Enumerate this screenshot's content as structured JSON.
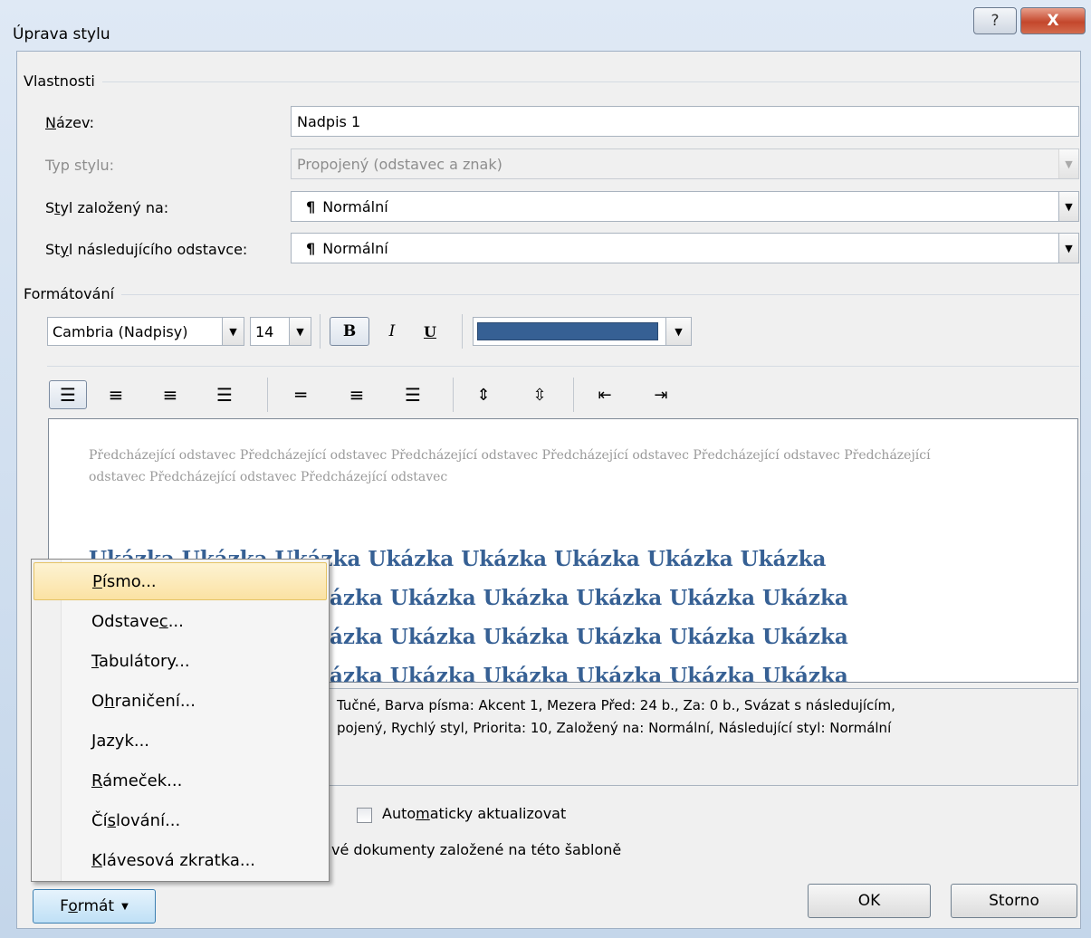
{
  "window": {
    "title": "Úprava stylu",
    "help_glyph": "?",
    "close_glyph": "X"
  },
  "properties": {
    "heading": "Vlastnosti",
    "name_label": "Název:",
    "name_value": "Nadpis 1",
    "type_label": "Typ stylu:",
    "type_value": "Propojený (odstavec a znak)",
    "based_label": "Styl založený na:",
    "based_value": "Normální",
    "next_label": "Styl následujícího odstavce:",
    "next_value": "Normální",
    "pilcrow": "¶"
  },
  "formatting": {
    "heading": "Formátování",
    "font": "Cambria (Nadpisy)",
    "size": "14",
    "bold": "B",
    "italic": "I",
    "underline": "U",
    "color": "#366094"
  },
  "preview": {
    "previous": "Předcházející odstavec Předcházející odstavec Předcházející odstavec Předcházející odstavec Předcházející odstavec Předcházející odstavec Předcházející odstavec Předcházející odstavec",
    "sample_line": "Ukázka Ukázka Ukázka Ukázka Ukázka Ukázka Ukázka Ukázka",
    "sample_visible": "ázka Ukázka Ukázka Ukázka Ukázka Ukázka"
  },
  "description": {
    "line1": "Tučné, Barva písma: Akcent 1, Mezera Před:  24 b., Za:  0 b., Svázat s následujícím,",
    "line2": "pojený, Rychlý styl, Priorita: 10, Založený na: Normální, Následující styl: Normální"
  },
  "auto_update_label": "Automaticky aktualizovat",
  "template_text": "vé dokumenty založené na této šabloně",
  "buttons": {
    "format": "Formát",
    "ok": "OK",
    "cancel": "Storno"
  },
  "menu": {
    "items": [
      {
        "pre": "",
        "key": "P",
        "post": "ísmo..."
      },
      {
        "pre": "Odstave",
        "key": "c",
        "post": "..."
      },
      {
        "pre": "",
        "key": "T",
        "post": "abulátory..."
      },
      {
        "pre": "O",
        "key": "h",
        "post": "raničení..."
      },
      {
        "pre": "",
        "key": "J",
        "post": "azyk..."
      },
      {
        "pre": "",
        "key": "R",
        "post": "ámeček..."
      },
      {
        "pre": "Čí",
        "key": "s",
        "post": "lování..."
      },
      {
        "pre": "",
        "key": "K",
        "post": "lávesová zkratka..."
      }
    ]
  }
}
